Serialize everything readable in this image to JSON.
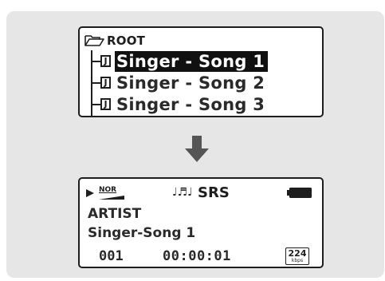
{
  "browser": {
    "root_label": "ROOT",
    "track_icon_glyph": "J",
    "tracks": [
      {
        "title": "Singer - Song 1",
        "selected": true
      },
      {
        "title": "Singer - Song 2",
        "selected": false
      },
      {
        "title": "Singer - Song 3",
        "selected": false
      }
    ]
  },
  "player": {
    "eq_mode": "NOR",
    "music_glyph": "♩♬♩",
    "srs_label": "SRS",
    "artist": "ARTIST",
    "song": "Singer-Song 1",
    "track_number": "001",
    "elapsed": "00:00:01",
    "bitrate_value": "224",
    "bitrate_unit": "kbps"
  },
  "colors": {
    "panel_bg": "#e6e6e6",
    "lcd_border": "#1e1e1e",
    "highlight_bg": "#111111",
    "arrow": "#555555"
  },
  "icons": [
    "folder-icon",
    "music-file-icon",
    "down-arrow-icon",
    "play-icon",
    "equalizer-ramp-icon",
    "music-notes-icon",
    "battery-icon"
  ]
}
